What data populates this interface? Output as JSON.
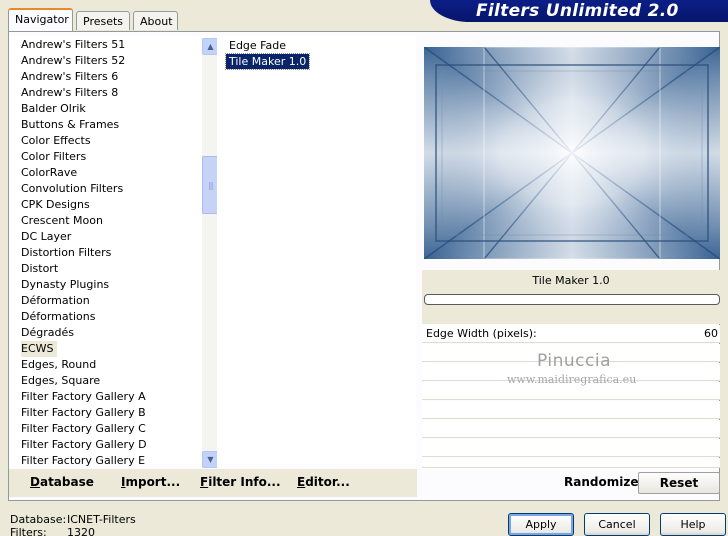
{
  "window": {
    "title": "Filters Unlimited 2.0",
    "tabs": [
      "Navigator",
      "Presets",
      "About"
    ]
  },
  "categories": {
    "items": [
      "Andrew's Filters 51",
      "Andrew's Filters 52",
      "Andrew's Filters 6",
      "Andrew's Filters 8",
      "Balder Olrik",
      "Buttons & Frames",
      "Color Effects",
      "Color Filters",
      "ColorRave",
      "Convolution Filters",
      "CPK Designs",
      "Crescent Moon",
      "DC Layer",
      "Distortion Filters",
      "Distort",
      "Dynasty Plugins",
      "Déformation",
      "Déformations",
      "Dégradés",
      "ECWS",
      "Edges, Round",
      "Edges, Square",
      "Filter Factory Gallery A",
      "Filter Factory Gallery B",
      "Filter Factory Gallery C",
      "Filter Factory Gallery D",
      "Filter Factory Gallery E"
    ],
    "selected": "ECWS"
  },
  "filters": {
    "items": [
      "Edge Fade",
      "Tile Maker 1.0"
    ],
    "selected": "Tile Maker 1.0"
  },
  "filter_panel": {
    "name": "Tile Maker 1.0",
    "param_label": "Edge Width (pixels):",
    "param_value": "60"
  },
  "watermark": {
    "name": "Pinuccia",
    "url": "www.maidiregrafica.eu"
  },
  "toolbar": {
    "database": "Database",
    "import": "Import...",
    "filter_info": "Filter Info...",
    "editor": "Editor...",
    "randomize": "Randomize",
    "reset": "Reset"
  },
  "status": {
    "database_label": "Database:",
    "database_value": "ICNET-Filters",
    "filters_label": "Filters:",
    "filters_value": "1320"
  },
  "dialog": {
    "apply": "Apply",
    "cancel": "Cancel",
    "help": "Help"
  },
  "colors": {
    "banner": "#0b1f87",
    "selection": "#0a246a",
    "preview_dark": "#1f4a7d",
    "preview_light": "#f4f6f9"
  },
  "icons": {
    "scroll_up": "chevron-up-icon",
    "scroll_down": "chevron-down-icon"
  }
}
